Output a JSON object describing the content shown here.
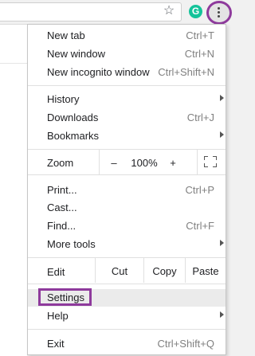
{
  "toolbar": {
    "star_icon": "☆",
    "grammarly_letter": "G",
    "menu_icon": "vertical-dots"
  },
  "menu": {
    "new_tab": {
      "label": "New tab",
      "shortcut": "Ctrl+T"
    },
    "new_window": {
      "label": "New window",
      "shortcut": "Ctrl+N"
    },
    "new_incognito": {
      "label": "New incognito window",
      "shortcut": "Ctrl+Shift+N"
    },
    "history": {
      "label": "History"
    },
    "downloads": {
      "label": "Downloads",
      "shortcut": "Ctrl+J"
    },
    "bookmarks": {
      "label": "Bookmarks"
    },
    "zoom": {
      "label": "Zoom",
      "minus": "–",
      "value": "100%",
      "plus": "+"
    },
    "print": {
      "label": "Print...",
      "shortcut": "Ctrl+P"
    },
    "cast": {
      "label": "Cast..."
    },
    "find": {
      "label": "Find...",
      "shortcut": "Ctrl+F"
    },
    "more_tools": {
      "label": "More tools"
    },
    "edit": {
      "label": "Edit",
      "cut": "Cut",
      "copy": "Copy",
      "paste": "Paste"
    },
    "settings": {
      "label": "Settings"
    },
    "help": {
      "label": "Help"
    },
    "exit": {
      "label": "Exit",
      "shortcut": "Ctrl+Shift+Q"
    }
  },
  "colors": {
    "annotation": "#8e3a9c",
    "grammarly": "#15c39a"
  }
}
